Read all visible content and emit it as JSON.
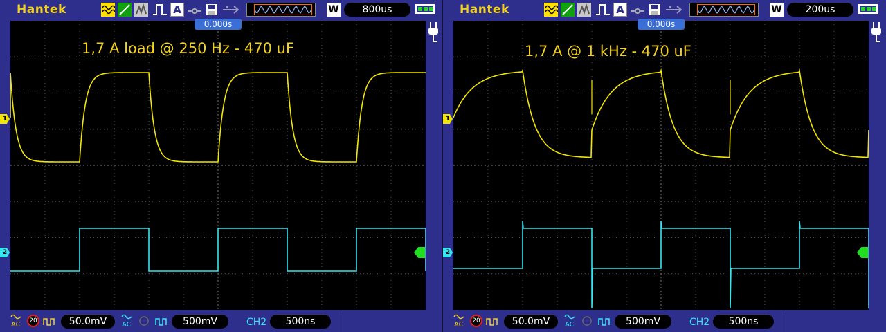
{
  "brand": "Hantek",
  "scopes": [
    {
      "timebase": "800us",
      "trigger_position": "0.000s",
      "annotation": "1,7 A load @ 250 Hz - 470 uF",
      "ch1_marker": "1",
      "ch2_marker": "2",
      "trigger_marker": "T",
      "ch1_volts": "50.0mV",
      "ch1_bw_limit": "20",
      "ch1_coupling": "AC",
      "ch2_volts": "500mV",
      "ch2_coupling": "AC",
      "trigger_source": "CH2",
      "trigger_value": "500ns"
    },
    {
      "timebase": "200us",
      "trigger_position": "0.000s",
      "annotation": "1,7 A @ 1 kHz - 470 uF",
      "ch1_marker": "1",
      "ch2_marker": "2",
      "trigger_marker": "T",
      "ch1_volts": "50.0mV",
      "ch1_bw_limit": "20",
      "ch1_coupling": "AC",
      "ch2_volts": "500mV",
      "ch2_coupling": "AC",
      "trigger_source": "CH2",
      "trigger_value": "500ns"
    }
  ],
  "toolbar": {
    "icons": [
      "waveform-icon",
      "slope-icon",
      "persistence-icon",
      "pulse-icon",
      "auto-icon",
      "link-icon",
      "save-icon",
      "usb-icon"
    ],
    "run_state_icon": "running-waveform-icon",
    "w_label": "W"
  },
  "colors": {
    "ch1": "#f2e600",
    "ch2": "#35e6f0",
    "background": "#2e2e8c",
    "brand": "#f2d21c",
    "trigger": "#22dd22"
  }
}
